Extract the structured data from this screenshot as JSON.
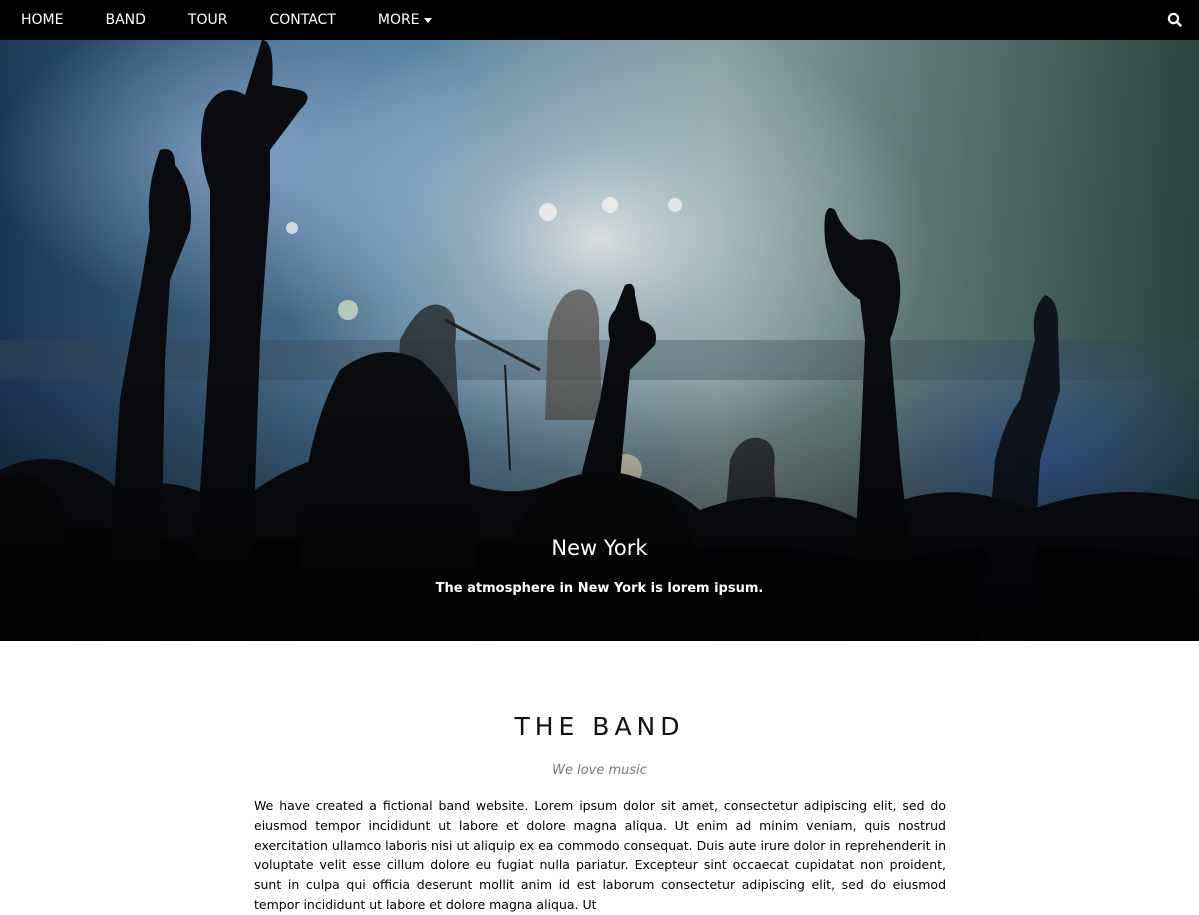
{
  "nav": {
    "items": [
      {
        "label": "HOME"
      },
      {
        "label": "BAND"
      },
      {
        "label": "TOUR"
      },
      {
        "label": "CONTACT"
      },
      {
        "label": "MORE"
      }
    ],
    "search_icon": "search-icon",
    "more_icon": "caret-down-icon"
  },
  "hero": {
    "title": "New York",
    "subtitle": "The atmosphere in New York is lorem ipsum."
  },
  "band": {
    "title": "THE BAND",
    "tagline": "We love music",
    "text": "We have created a fictional band website. Lorem ipsum dolor sit amet, consectetur adipiscing elit, sed do eiusmod tempor incididunt ut labore et dolore magna aliqua. Ut enim ad minim veniam, quis nostrud exercitation ullamco laboris nisi ut aliquip ex ea commodo consequat. Duis aute irure dolor in reprehenderit in voluptate velit esse cillum dolore eu fugiat nulla pariatur. Excepteur sint occaecat cupidatat non proident, sunt in culpa qui officia deserunt mollit anim id est laborum consectetur adipiscing elit, sed do eiusmod tempor incididunt ut labore et dolore magna aliqua. Ut"
  },
  "colors": {
    "navbar": "#000000",
    "nav_text": "#ffffff",
    "tagline": "#777777"
  }
}
